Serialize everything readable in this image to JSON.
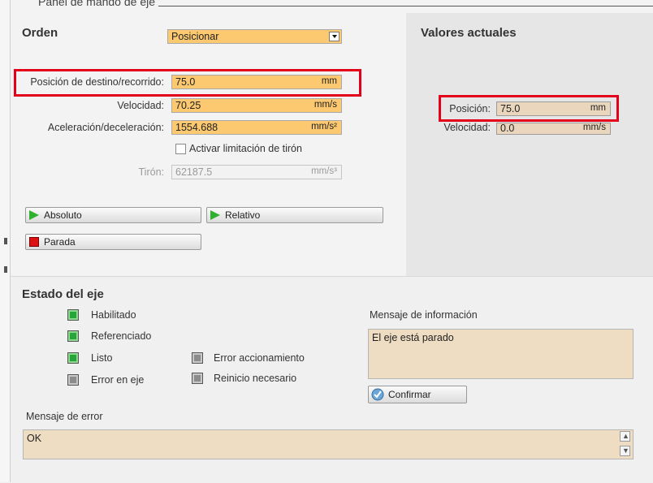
{
  "panel": {
    "title": "Panel de mando de eje"
  },
  "orden": {
    "title": "Orden",
    "mode_selected": "Posicionar",
    "target": {
      "label": "Posición de destino/recorrido:",
      "value": "75.0",
      "unit": "mm"
    },
    "velocity": {
      "label": "Velocidad:",
      "value": "70.25",
      "unit": "mm/s"
    },
    "accel": {
      "label": "Aceleración/deceleración:",
      "value": "1554.688",
      "unit": "mm/s²"
    },
    "jerk_limit": {
      "label": "Activar limitación de tirón",
      "checked": false
    },
    "jerk": {
      "label": "Tirón:",
      "value": "62187.5",
      "unit": "mm/s³"
    },
    "buttons": {
      "absolute": "Absoluto",
      "relative": "Relativo",
      "stop": "Parada"
    }
  },
  "actual": {
    "title": "Valores actuales",
    "position": {
      "label": "Posición:",
      "value": "75.0",
      "unit": "mm"
    },
    "velocity": {
      "label": "Velocidad:",
      "value": "0.0",
      "unit": "mm/s"
    }
  },
  "status": {
    "title": "Estado del eje",
    "items": [
      {
        "label": "Habilitado",
        "on": true
      },
      {
        "label": "Referenciado",
        "on": true
      },
      {
        "label": "Listo",
        "on": true
      },
      {
        "label": "Error en eje",
        "on": false
      },
      {
        "label": "Error accionamiento",
        "on": false
      },
      {
        "label": "Reinicio necesario",
        "on": false
      }
    ]
  },
  "info": {
    "label": "Mensaje de información",
    "text": "El eje está parado",
    "confirm": "Confirmar"
  },
  "error": {
    "label": "Mensaje de error",
    "text": "OK"
  },
  "colors": {
    "highlight": "#e3001b",
    "editable_field": "#fcc870",
    "readonly_field": "#efddc3",
    "status_on": "#27a43a"
  }
}
